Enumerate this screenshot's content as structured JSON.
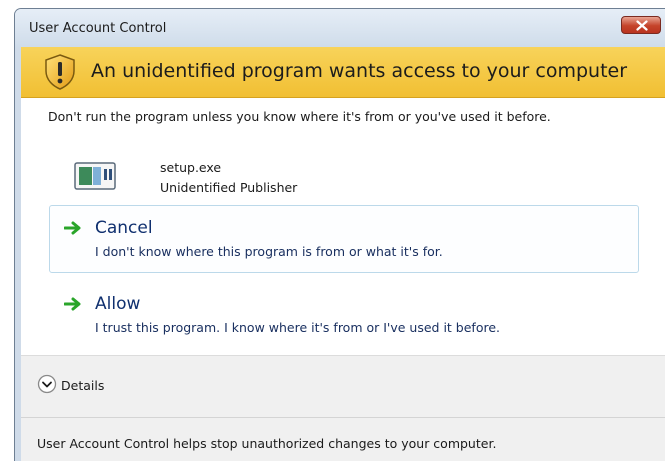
{
  "window": {
    "title": "User Account Control"
  },
  "banner": {
    "heading": "An unidentified program wants access to your computer"
  },
  "warning": {
    "text": "Don't run the program unless you know where it's from or you've used it before."
  },
  "program": {
    "name": "setup.exe",
    "publisher": "Unidentified Publisher"
  },
  "options": [
    {
      "title": "Cancel",
      "description": "I don't know where this program is from or what it's for."
    },
    {
      "title": "Allow",
      "description": "I trust this program. I know where it's from or I've used it before."
    }
  ],
  "details": {
    "label": "Details"
  },
  "footer": {
    "text": "User Account Control helps stop unauthorized changes to your computer."
  },
  "icons": {
    "shield": "warning-shield-icon",
    "program": "application-icon",
    "option_arrow": "green-arrow-icon",
    "details_toggle": "chevron-down-circle-icon",
    "close": "close-icon"
  },
  "colors": {
    "banner": "#f1bf33",
    "option_title": "#10306f",
    "arrow": "#2aa52a",
    "close_button": "#c5432a"
  }
}
